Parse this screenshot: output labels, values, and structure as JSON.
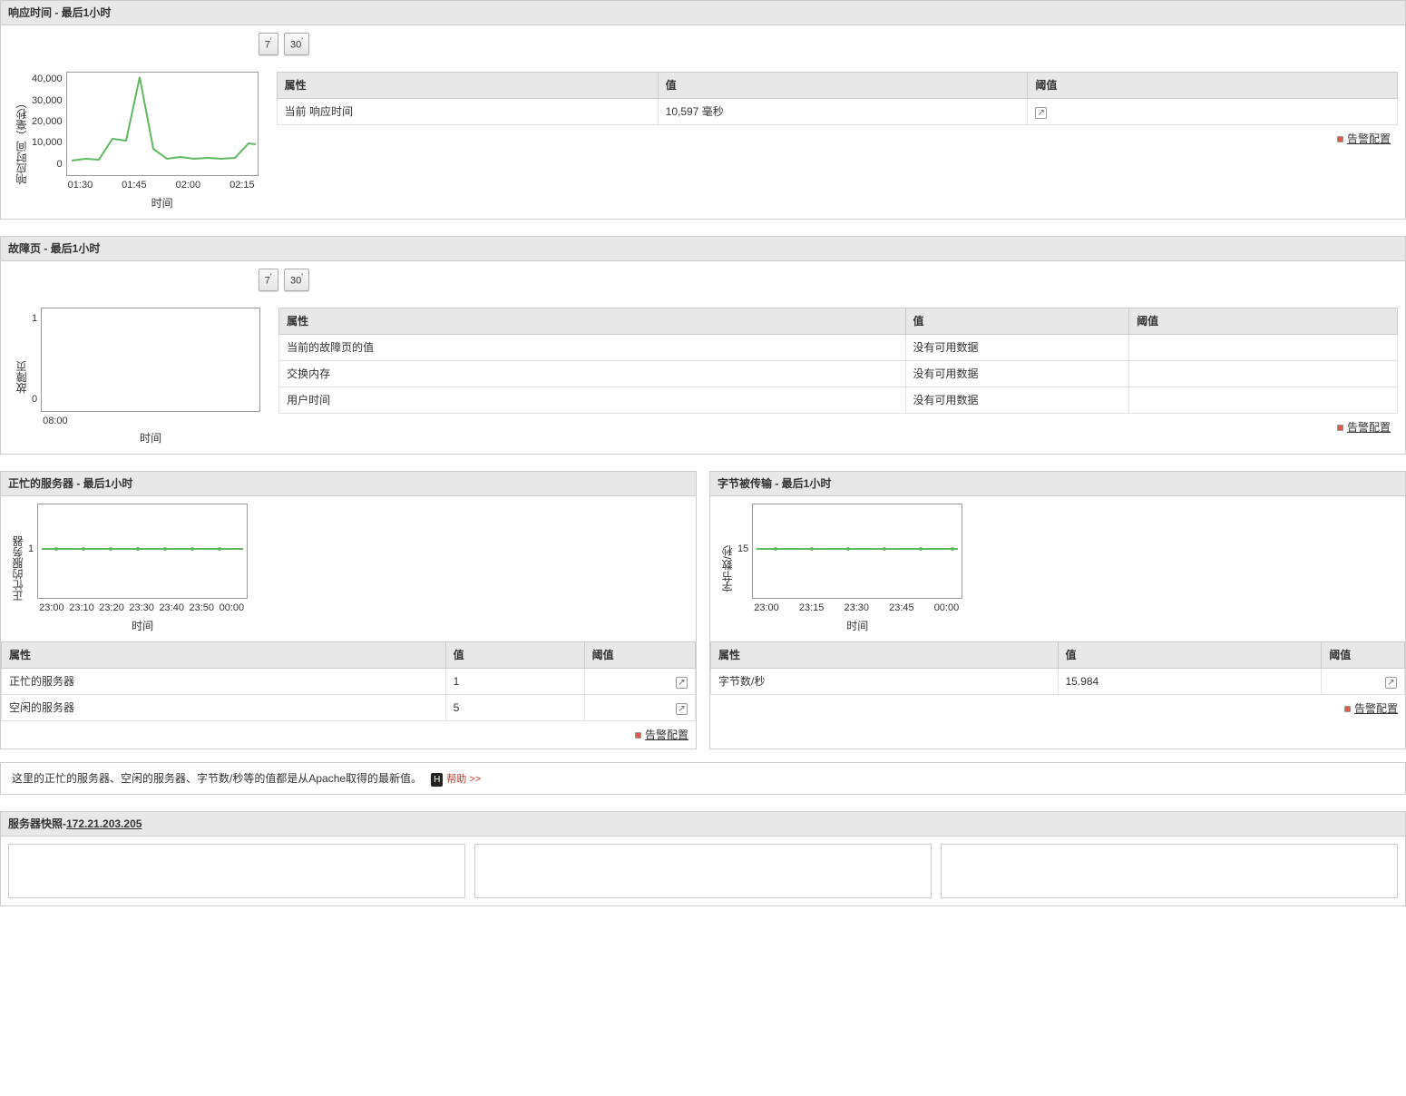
{
  "period_buttons": {
    "seven": "7",
    "thirty": "30"
  },
  "common": {
    "xlabel": "时间",
    "alarm_config": "告警配置"
  },
  "response": {
    "title": "响应时间 - 最后1小时",
    "ylabel": "响应时间（毫秒）",
    "chart_data": {
      "type": "line",
      "xticks": [
        "01:30",
        "01:45",
        "02:00",
        "02:15"
      ],
      "yticks": [
        "40,000",
        "30,000",
        "20,000",
        "10,000",
        "0"
      ],
      "ylim": [
        0,
        40000
      ],
      "values": [
        4000,
        5000,
        4500,
        13000,
        12000,
        40000,
        9000,
        5000,
        6000,
        5000,
        5500,
        5000,
        5500,
        11000,
        10500
      ]
    },
    "table": {
      "headers": {
        "attr": "属性",
        "value": "值",
        "threshold": "阈值"
      },
      "rows": [
        {
          "attr": "当前 响应时间",
          "value": "10,597 毫秒",
          "threshold_icon": true
        }
      ]
    }
  },
  "faults": {
    "title": "故障页 - 最后1小时",
    "ylabel": "故障页",
    "chart_data": {
      "type": "line",
      "xticks": [
        "08:00"
      ],
      "yticks": [
        "1",
        "0"
      ],
      "ylim": [
        0,
        1
      ],
      "values": []
    },
    "table": {
      "headers": {
        "attr": "属性",
        "value": "值",
        "threshold": "阈值"
      },
      "rows": [
        {
          "attr": "当前的故障页的值",
          "value": "没有可用数据"
        },
        {
          "attr": "交换内存",
          "value": "没有可用数据"
        },
        {
          "attr": "用户时间",
          "value": "没有可用数据"
        }
      ]
    }
  },
  "busy": {
    "title": "正忙的服务器 - 最后1小时",
    "ylabel": "正忙的服务器",
    "chart_data": {
      "type": "line",
      "xticks": [
        "23:00",
        "23:10",
        "23:20",
        "23:30",
        "23:40",
        "23:50",
        "00:00"
      ],
      "yticks": [
        "1"
      ],
      "flat_value": 1
    },
    "table": {
      "headers": {
        "attr": "属性",
        "value": "值",
        "threshold": "阈值"
      },
      "rows": [
        {
          "attr": "正忙的服务器",
          "value": "1",
          "threshold_icon": true
        },
        {
          "attr": "空闲的服务器",
          "value": "5",
          "threshold_icon": true
        }
      ]
    }
  },
  "bytes": {
    "title": "字节被传输 - 最后1小时",
    "ylabel": "字节数/秒",
    "chart_data": {
      "type": "line",
      "xticks": [
        "23:00",
        "23:15",
        "23:30",
        "23:45",
        "00:00"
      ],
      "yticks": [
        "15"
      ],
      "flat_value": 15
    },
    "table": {
      "headers": {
        "attr": "属性",
        "value": "值",
        "threshold": "阈值"
      },
      "rows": [
        {
          "attr": "字节数/秒",
          "value": "15.984",
          "threshold_icon": true
        }
      ]
    }
  },
  "help": {
    "text": "这里的正忙的服务器、空闲的服务器、字节数/秒等的值都是从Apache取得的最新值。",
    "link": "帮助 >>"
  },
  "snapshot": {
    "label": "服务器快照-",
    "ip": "172.21.203.205"
  }
}
